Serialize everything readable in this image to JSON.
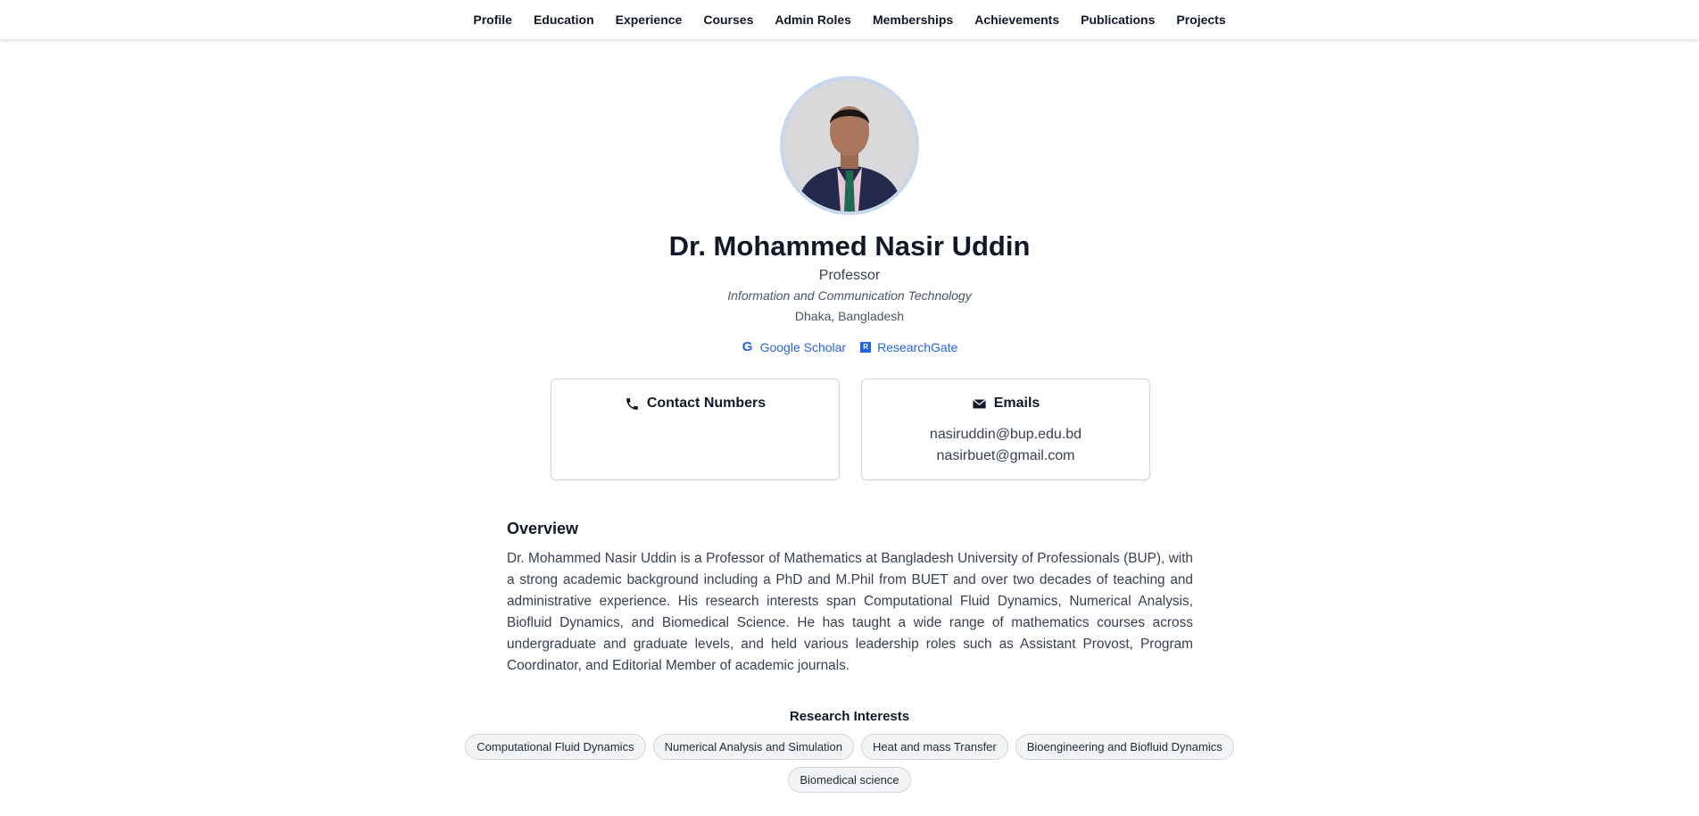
{
  "nav": {
    "items": [
      "Profile",
      "Education",
      "Experience",
      "Courses",
      "Admin Roles",
      "Memberships",
      "Achievements",
      "Publications",
      "Projects"
    ]
  },
  "profile": {
    "name": "Dr. Mohammed Nasir Uddin",
    "role": "Professor",
    "department": "Information and Communication Technology",
    "location": "Dhaka, Bangladesh"
  },
  "links": {
    "scholar_label": "Google Scholar",
    "researchgate_label": "ResearchGate",
    "scholar_icon": "google-icon",
    "researchgate_icon": "researchgate-icon",
    "link_color": "#2563eb"
  },
  "contact": {
    "phones_title": "Contact Numbers",
    "phones": [],
    "emails_title": "Emails",
    "emails": [
      "nasiruddin@bup.edu.bd",
      "nasirbuet@gmail.com"
    ]
  },
  "overview": {
    "title": "Overview",
    "text": "Dr. Mohammed Nasir Uddin is a Professor of Mathematics at Bangladesh University of Professionals (BUP), with a strong academic background including a PhD and M.Phil from BUET and over two decades of teaching and administrative experience. His research interests span Computational Fluid Dynamics, Numerical Analysis, Biofluid Dynamics, and Biomedical Science. He has taught a wide range of mathematics courses across undergraduate and graduate levels, and held various leadership roles such as Assistant Provost, Program Coordinator, and Editorial Member of academic journals."
  },
  "research": {
    "title": "Research Interests",
    "interests": [
      "Computational Fluid Dynamics",
      "Numerical Analysis and Simulation",
      "Heat and mass Transfer",
      "Bioengineering and Biofluid Dynamics",
      "Biomedical science"
    ]
  }
}
